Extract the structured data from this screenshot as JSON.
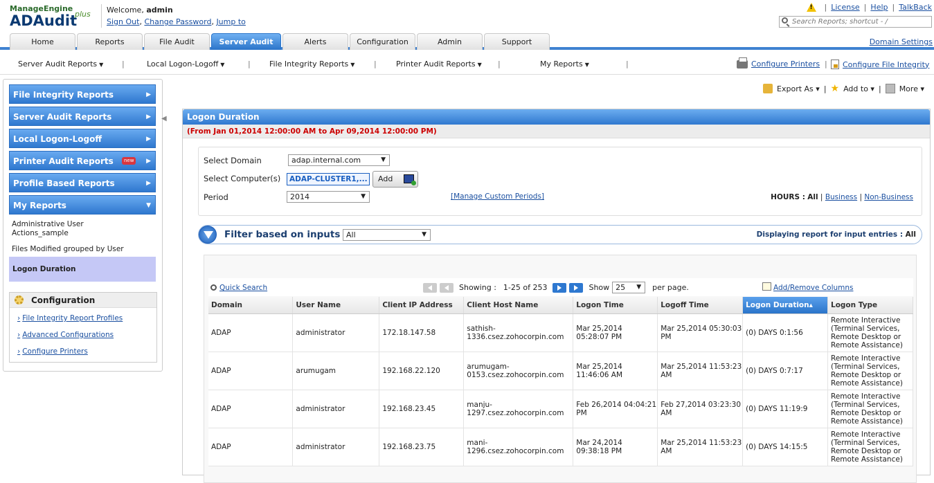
{
  "app": {
    "vendor": "ManageEngine",
    "product": "ADAudit",
    "product_suffix": "plus"
  },
  "welcome": {
    "text": "Welcome,",
    "user": "admin",
    "sign_out": "Sign Out",
    "change_password": "Change Password",
    "jump_to": "Jump to"
  },
  "toplinks": {
    "license": "License",
    "help": "Help",
    "talkback": "TalkBack",
    "sep": "|"
  },
  "search": {
    "placeholder": "Search Reports; shortcut - /"
  },
  "tabs": [
    {
      "label": "Home"
    },
    {
      "label": "Reports"
    },
    {
      "label": "File Audit"
    },
    {
      "label": "Server Audit",
      "active": true
    },
    {
      "label": "Alerts"
    },
    {
      "label": "Configuration"
    },
    {
      "label": "Admin"
    },
    {
      "label": "Support"
    }
  ],
  "domain_settings": "Domain Settings",
  "subnav": {
    "items": [
      {
        "label": "Server Audit Reports"
      },
      {
        "label": "Local Logon-Logoff"
      },
      {
        "label": "File Integrity Reports"
      },
      {
        "label": "Printer Audit Reports"
      },
      {
        "label": "My Reports"
      }
    ],
    "configure_printers": "Configure Printers",
    "configure_file_integrity": "Configure File Integrity"
  },
  "sidebar": {
    "menus": [
      {
        "label": "File Integrity Reports"
      },
      {
        "label": "Server Audit Reports"
      },
      {
        "label": "Local Logon-Logoff"
      },
      {
        "label": "Printer Audit Reports",
        "badge": "new"
      },
      {
        "label": "Profile Based Reports"
      },
      {
        "label": "My Reports"
      }
    ],
    "my_reports": [
      {
        "label": "Administrative User Actions_sample"
      },
      {
        "label": "Files Modified grouped by User"
      },
      {
        "label": "Logon Duration",
        "selected": true
      }
    ],
    "configuration": {
      "title": "Configuration",
      "items": [
        {
          "label": "File Integrity Report Profiles"
        },
        {
          "label": "Advanced Configurations"
        },
        {
          "label": "Configure Printers"
        }
      ]
    }
  },
  "actions": {
    "export": "Export As",
    "add_to": "Add to",
    "more": "More"
  },
  "report": {
    "title": "Logon Duration",
    "date_range": "(From Jan 01,2014 12:00:00 AM to Apr 09,2014 12:00:00 PM)",
    "form": {
      "domain_label": "Select Domain",
      "domain_value": "adap.internal.com",
      "computers_label": "Select Computer(s)",
      "computers_value": "ADAP-CLUSTER1,...",
      "add_label": "Add",
      "period_label": "Period",
      "period_value": "2014",
      "manage_custom": "[Manage Custom Periods]",
      "hours_label": "HOURS :",
      "hours_all": "All",
      "hours_business": "Business",
      "hours_nonbusiness": "Non-Business"
    },
    "filter": {
      "label": "Filter based on inputs",
      "value": "All",
      "display_text": "Displaying report for input entries :",
      "display_value": "All"
    },
    "toolbar": {
      "quick_search": "Quick Search",
      "showing": "Showing :",
      "range": "1-25 of 253",
      "show": "Show",
      "per_page_value": "25",
      "per_page": "per page.",
      "add_remove": "Add/Remove Columns"
    },
    "columns": [
      "Domain",
      "User Name",
      "Client IP Address",
      "Client Host Name",
      "Logon Time",
      "Logoff Time",
      "Logon Duration▴",
      "Logon Type"
    ],
    "rows": [
      [
        "ADAP",
        "administrator",
        "172.18.147.58",
        "sathish-1336.csez.zohocorpin.com",
        "Mar 25,2014 05:28:07 PM",
        "Mar 25,2014 05:30:03 PM",
        "(0) DAYS 0:1:56",
        "Remote Interactive (Terminal Services, Remote Desktop or Remote Assistance)"
      ],
      [
        "ADAP",
        "arumugam",
        "192.168.22.120",
        "arumugam-0153.csez.zohocorpin.com",
        "Mar 25,2014 11:46:06 AM",
        "Mar 25,2014 11:53:23 AM",
        "(0) DAYS 0:7:17",
        "Remote Interactive (Terminal Services, Remote Desktop or Remote Assistance)"
      ],
      [
        "ADAP",
        "administrator",
        "192.168.23.45",
        "manju-1297.csez.zohocorpin.com",
        "Feb 26,2014 04:04:21 PM",
        "Feb 27,2014 03:23:30 AM",
        "(0) DAYS 11:19:9",
        "Remote Interactive (Terminal Services, Remote Desktop or Remote Assistance)"
      ],
      [
        "ADAP",
        "administrator",
        "192.168.23.75",
        "mani-1296.csez.zohocorpin.com",
        "Mar 24,2014 09:38:18 PM",
        "Mar 25,2014 11:53:23 AM",
        "(0) DAYS 14:15:5",
        "Remote Interactive (Terminal Services, Remote Desktop or Remote Assistance)"
      ]
    ]
  }
}
